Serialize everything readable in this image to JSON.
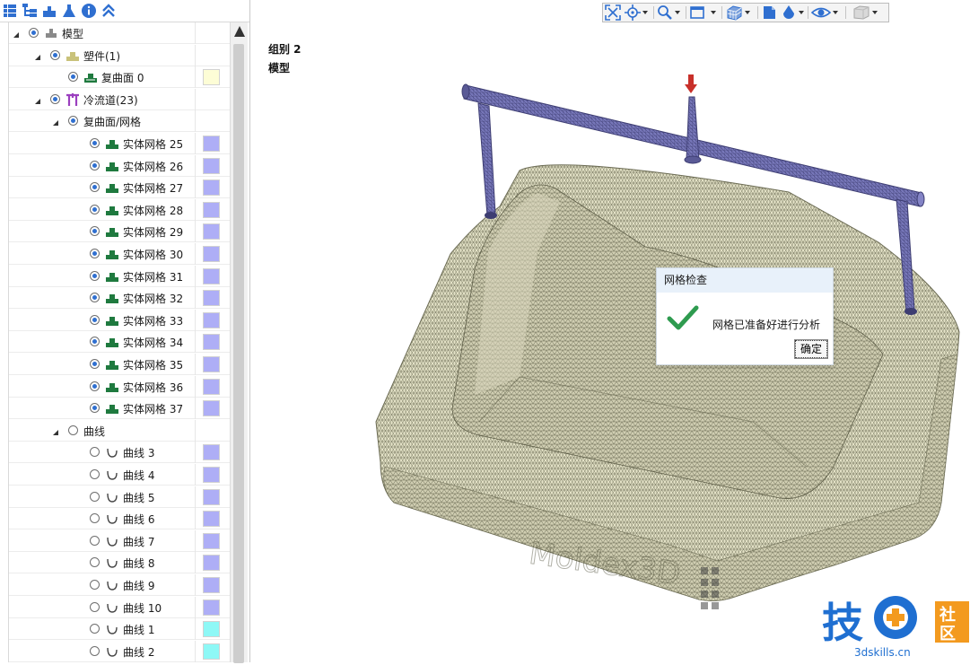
{
  "panel_toolbar": {
    "icons": [
      "layers-icon",
      "tree-icon",
      "mold-icon",
      "flask-icon",
      "info-icon",
      "collapse-icon"
    ]
  },
  "tree": {
    "rows": [
      {
        "label": "模型",
        "level": 0,
        "expanded": true,
        "radio": "on",
        "icon": "model-icon",
        "swatch": null
      },
      {
        "label": "塑件(1)",
        "level": 1,
        "expanded": true,
        "radio": "on",
        "icon": "part-icon",
        "swatch": null
      },
      {
        "label": "复曲面 0",
        "level": 2,
        "expanded": null,
        "radio": "on",
        "icon": "surface-icon",
        "swatch": "#fdfdd6"
      },
      {
        "label": "冷流道(23)",
        "level": 1,
        "expanded": true,
        "radio": "on",
        "icon": "runner-icon",
        "swatch": null
      },
      {
        "label": "复曲面/网格",
        "level": 2,
        "expanded": true,
        "radio": "on",
        "icon": null,
        "swatch": null
      },
      {
        "label": "实体网格 25",
        "level": 3,
        "expanded": null,
        "radio": "on",
        "icon": "solid-mesh-icon",
        "swatch": "#aeaef6"
      },
      {
        "label": "实体网格 26",
        "level": 3,
        "expanded": null,
        "radio": "on",
        "icon": "solid-mesh-icon",
        "swatch": "#aeaef6"
      },
      {
        "label": "实体网格 27",
        "level": 3,
        "expanded": null,
        "radio": "on",
        "icon": "solid-mesh-icon",
        "swatch": "#aeaef6"
      },
      {
        "label": "实体网格 28",
        "level": 3,
        "expanded": null,
        "radio": "on",
        "icon": "solid-mesh-icon",
        "swatch": "#aeaef6"
      },
      {
        "label": "实体网格 29",
        "level": 3,
        "expanded": null,
        "radio": "on",
        "icon": "solid-mesh-icon",
        "swatch": "#aeaef6"
      },
      {
        "label": "实体网格 30",
        "level": 3,
        "expanded": null,
        "radio": "on",
        "icon": "solid-mesh-icon",
        "swatch": "#aeaef6"
      },
      {
        "label": "实体网格 31",
        "level": 3,
        "expanded": null,
        "radio": "on",
        "icon": "solid-mesh-icon",
        "swatch": "#aeaef6"
      },
      {
        "label": "实体网格 32",
        "level": 3,
        "expanded": null,
        "radio": "on",
        "icon": "solid-mesh-icon",
        "swatch": "#aeaef6"
      },
      {
        "label": "实体网格 33",
        "level": 3,
        "expanded": null,
        "radio": "on",
        "icon": "solid-mesh-icon",
        "swatch": "#aeaef6"
      },
      {
        "label": "实体网格 34",
        "level": 3,
        "expanded": null,
        "radio": "on",
        "icon": "solid-mesh-icon",
        "swatch": "#aeaef6"
      },
      {
        "label": "实体网格 35",
        "level": 3,
        "expanded": null,
        "radio": "on",
        "icon": "solid-mesh-icon",
        "swatch": "#aeaef6"
      },
      {
        "label": "实体网格 36",
        "level": 3,
        "expanded": null,
        "radio": "on",
        "icon": "solid-mesh-icon",
        "swatch": "#aeaef6"
      },
      {
        "label": "实体网格 37",
        "level": 3,
        "expanded": null,
        "radio": "on",
        "icon": "solid-mesh-icon",
        "swatch": "#aeaef6"
      },
      {
        "label": "曲线",
        "level": 2,
        "expanded": true,
        "radio": "off",
        "icon": null,
        "swatch": null
      },
      {
        "label": "曲线 3",
        "level": 3,
        "expanded": null,
        "radio": "off",
        "icon": "curve-icon",
        "swatch": "#aeaef6"
      },
      {
        "label": "曲线 4",
        "level": 3,
        "expanded": null,
        "radio": "off",
        "icon": "curve-icon",
        "swatch": "#aeaef6"
      },
      {
        "label": "曲线 5",
        "level": 3,
        "expanded": null,
        "radio": "off",
        "icon": "curve-icon",
        "swatch": "#aeaef6"
      },
      {
        "label": "曲线 6",
        "level": 3,
        "expanded": null,
        "radio": "off",
        "icon": "curve-icon",
        "swatch": "#aeaef6"
      },
      {
        "label": "曲线 7",
        "level": 3,
        "expanded": null,
        "radio": "off",
        "icon": "curve-icon",
        "swatch": "#aeaef6"
      },
      {
        "label": "曲线 8",
        "level": 3,
        "expanded": null,
        "radio": "off",
        "icon": "curve-icon",
        "swatch": "#aeaef6"
      },
      {
        "label": "曲线 9",
        "level": 3,
        "expanded": null,
        "radio": "off",
        "icon": "curve-icon",
        "swatch": "#aeaef6"
      },
      {
        "label": "曲线 10",
        "level": 3,
        "expanded": null,
        "radio": "off",
        "icon": "curve-icon",
        "swatch": "#aeaef6"
      },
      {
        "label": "曲线 1",
        "level": 3,
        "expanded": null,
        "radio": "off",
        "icon": "curve-icon",
        "swatch": "#8ef8f6"
      },
      {
        "label": "曲线 2",
        "level": 3,
        "expanded": null,
        "radio": "off",
        "icon": "curve-icon",
        "swatch": "#8ef8f6"
      }
    ]
  },
  "viewport": {
    "label_group": "组别 2",
    "label_model": "模型"
  },
  "view_toolbar": {
    "tools": [
      "fit-view-icon",
      "rotate-center-icon",
      "zoom-icon",
      "view-direction-icon",
      "display-mode-icon",
      "section-icon",
      "color-icon",
      "visibility-icon",
      "transparency-icon"
    ]
  },
  "dialog": {
    "title": "网格检查",
    "message": "网格已准备好进行分析",
    "ok_label": "确定"
  },
  "watermark": {
    "char_1": "技",
    "char_2": "社",
    "char_3": "区",
    "url": "3dskills.cn"
  },
  "colors": {
    "accent": "#2f6fd0",
    "runner": "#5a5a96",
    "part_mesh": "#8f8e6f",
    "solid_mesh_icon": "#1f7a3f",
    "check": "#2e9b4f",
    "watermark_blue": "#1f6fd1",
    "watermark_orange": "#f39a1f"
  }
}
